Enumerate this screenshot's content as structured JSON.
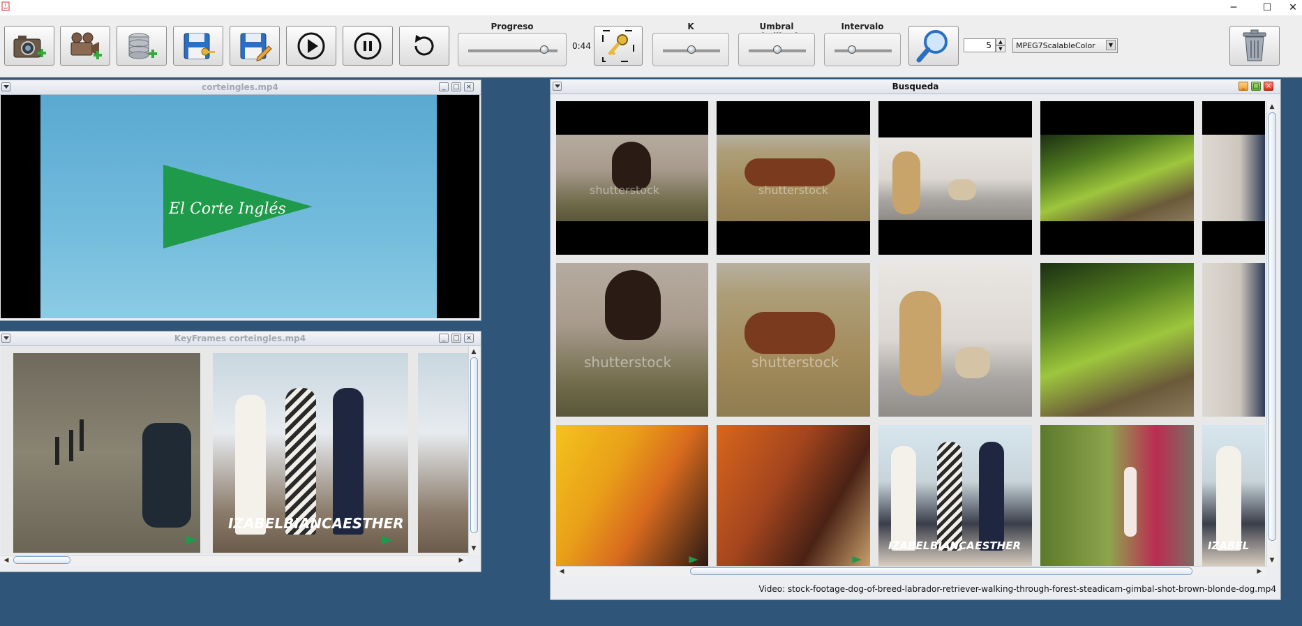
{
  "window": {
    "title": "",
    "controls": {
      "minimize": "─",
      "maximize": "☐",
      "close": "✕"
    }
  },
  "toolbar": {
    "buttons": [
      {
        "name": "add-image-button",
        "icon": "camera-add-icon"
      },
      {
        "name": "add-video-button",
        "icon": "video-camera-add-icon"
      },
      {
        "name": "add-database-button",
        "icon": "database-add-icon"
      },
      {
        "name": "save-key-button",
        "icon": "save-key-icon"
      },
      {
        "name": "save-edit-button",
        "icon": "save-edit-icon"
      },
      {
        "name": "play-button",
        "icon": "play-icon"
      },
      {
        "name": "pause-button",
        "icon": "pause-icon"
      },
      {
        "name": "reload-button",
        "icon": "rotate-icon"
      },
      {
        "name": "keyframe-button",
        "icon": "key-icon"
      },
      {
        "name": "search-button",
        "icon": "magnifier-icon"
      },
      {
        "name": "delete-button",
        "icon": "trash-icon"
      }
    ],
    "progress": {
      "label": "Progreso",
      "time": "0:44",
      "value": 0.85
    },
    "k": {
      "label": "K",
      "value": 0.5
    },
    "umbral": {
      "label": "Umbral Similitud",
      "value": 0.5
    },
    "intervalo": {
      "label": "Intervalo",
      "value": 0.3
    },
    "spinner": {
      "value": "5"
    },
    "descriptor": {
      "selected": "MPEG7ScalableColor"
    }
  },
  "player_frame": {
    "title": "corteingles.mp4",
    "logo_text": "El Corte Inglés",
    "colors": {
      "sky": "#64b2d6",
      "pennant": "#1f9a4a"
    }
  },
  "keyframes_frame": {
    "title": "KeyFrames corteingles.mp4",
    "caption": [
      "IZABEL",
      "BIANCA",
      "ESTHER"
    ]
  },
  "search_frame": {
    "title": "Busqueda",
    "grid": [
      [
        "stock video man thinking",
        "stock video horse grazing",
        "stock video girl with pug",
        "stock video forest path",
        "stock video partial"
      ],
      [
        "stock video man thinking",
        "stock video horse grazing",
        "stock video girl with pug",
        "stock video forest path",
        "stock video partial"
      ],
      [
        "party corteingles",
        "party corteingles",
        "corteingles models",
        "woman stairs",
        "corteingles models"
      ]
    ],
    "row3_caption": [
      "IZABEL",
      "BIANCA",
      "ESTHER"
    ],
    "row3_caption_partial": "IZABEL",
    "watermark": "shutterstock",
    "status": "Video: stock-footage-dog-of-breed-labrador-retriever-walking-through-forest-steadicam-gimbal-shot-brown-blonde-dog.mp4"
  }
}
